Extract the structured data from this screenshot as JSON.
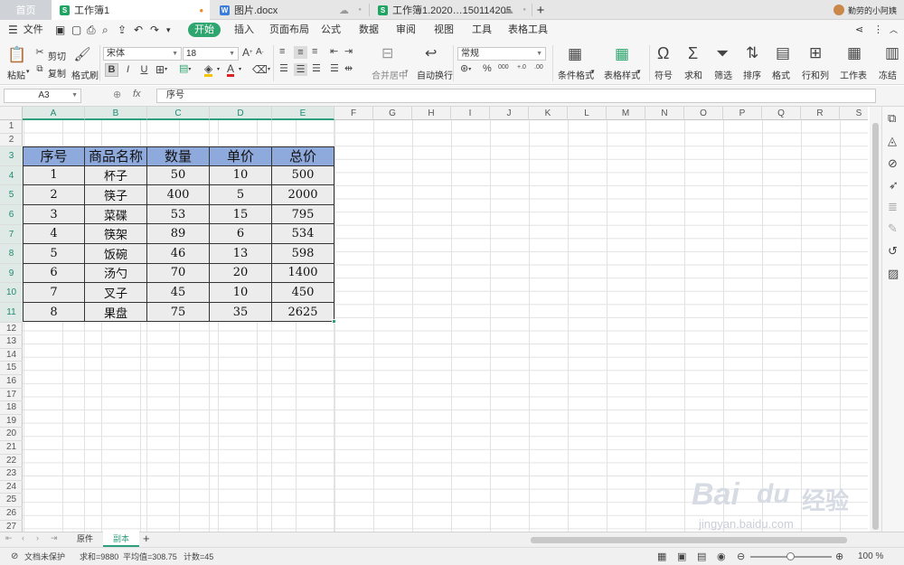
{
  "tabs": [
    {
      "label": "首页",
      "icon": "home-icon"
    },
    {
      "label": "工作簿1",
      "icon": "spreadsheet-icon",
      "unsaved_dot": "•"
    },
    {
      "label": "图片.docx",
      "icon": "document-icon",
      "cloud": "☁",
      "close": "●"
    },
    {
      "label": "工作簿1.2020…150114205",
      "icon": "spreadsheet-icon",
      "cloud": "☁",
      "close": "●"
    }
  ],
  "new_tab": "+",
  "user": {
    "name": "勤劳的小阿姨"
  },
  "menu": {
    "file": "文件",
    "items": [
      "开始",
      "插入",
      "页面布局",
      "公式",
      "数据",
      "审阅",
      "视图",
      "工具",
      "表格工具"
    ],
    "active": "开始"
  },
  "toolbar": {
    "paste": "粘贴",
    "cut": "剪切",
    "copy": "复制",
    "format_painter": "格式刷",
    "font_name": "宋体",
    "font_size": "18",
    "bold": "B",
    "italic": "I",
    "underline": "U",
    "merge": "合并居中",
    "wrap": "自动换行",
    "number_format": "常规",
    "percent": "%",
    "thousands": "000",
    "inc_dec": "+.0",
    "dec_dec": ".00",
    "conditional_format": "条件格式",
    "table_style": "表格样式",
    "symbol": "符号",
    "sum": "求和",
    "filter": "筛选",
    "sort": "排序",
    "format": "格式",
    "rows_cols": "行和列",
    "worksheet": "工作表",
    "freeze": "冻结"
  },
  "formula_bar": {
    "cell_ref": "A3",
    "fx": "fx",
    "content": "序号"
  },
  "columns": [
    "A",
    "B",
    "C",
    "D",
    "E",
    "F",
    "G",
    "H",
    "I",
    "J",
    "K",
    "L",
    "M",
    "N",
    "O",
    "P",
    "Q",
    "R",
    "S"
  ],
  "rows": [
    "1",
    "2",
    "3",
    "4",
    "5",
    "6",
    "7",
    "8",
    "9",
    "10",
    "11",
    "12",
    "13",
    "14",
    "15",
    "16",
    "17",
    "18",
    "19",
    "20",
    "21",
    "22",
    "23",
    "24",
    "25",
    "26",
    "27"
  ],
  "table": {
    "headers": [
      "序号",
      "商品名称",
      "数量",
      "单价",
      "总价"
    ],
    "rows": [
      [
        "1",
        "杯子",
        "50",
        "10",
        "500"
      ],
      [
        "2",
        "筷子",
        "400",
        "5",
        "2000"
      ],
      [
        "3",
        "菜碟",
        "53",
        "15",
        "795"
      ],
      [
        "4",
        "筷架",
        "89",
        "6",
        "534"
      ],
      [
        "5",
        "饭碗",
        "46",
        "13",
        "598"
      ],
      [
        "6",
        "汤勺",
        "70",
        "20",
        "1400"
      ],
      [
        "7",
        "叉子",
        "45",
        "10",
        "450"
      ],
      [
        "8",
        "果盘",
        "75",
        "35",
        "2625"
      ]
    ]
  },
  "sheets": [
    "原件",
    "副本"
  ],
  "active_sheet": "副本",
  "add_sheet": "+",
  "status": {
    "protect": "文档未保护",
    "sum": "求和=9880",
    "avg": "平均值=308.75",
    "count": "计数=45",
    "zoom": "100 %"
  },
  "watermark": {
    "logo": "Bai",
    "paw": "du",
    "cn": "经验",
    "url": "jingyan.baidu.com"
  },
  "colors": {
    "accent": "#2e9f7c",
    "header_fill": "#8ea9db",
    "row_fill": "#ececec"
  }
}
